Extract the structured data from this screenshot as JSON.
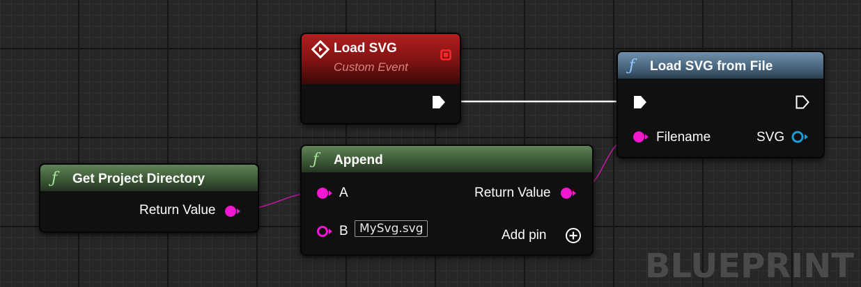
{
  "nodes": {
    "load_svg_event": {
      "title": "Load SVG",
      "subtitle": "Custom Event",
      "icon": "event-diamond-icon",
      "header_color": "#a01818"
    },
    "load_svg_from_file": {
      "title": "Load SVG from File",
      "icon": "function-icon",
      "header_color": "#4f6e88",
      "pins": {
        "input": "Filename",
        "output": "SVG"
      }
    },
    "get_project_directory": {
      "title": "Get Project Directory",
      "icon": "function-icon",
      "header_color": "#456a3f",
      "pins": {
        "output": "Return Value"
      }
    },
    "append": {
      "title": "Append",
      "icon": "function-icon",
      "header_color": "#456a3f",
      "pins": {
        "a": "A",
        "b": "B",
        "b_value": "MySvg.svg",
        "output": "Return Value",
        "add_pin": "Add pin"
      }
    }
  },
  "watermark": "BLUEPRINT",
  "colors": {
    "string_pin": "#f018d0",
    "object_pin": "#1a9ed8",
    "exec_wire": "#ffffff",
    "string_wire": "#c41aa8"
  }
}
